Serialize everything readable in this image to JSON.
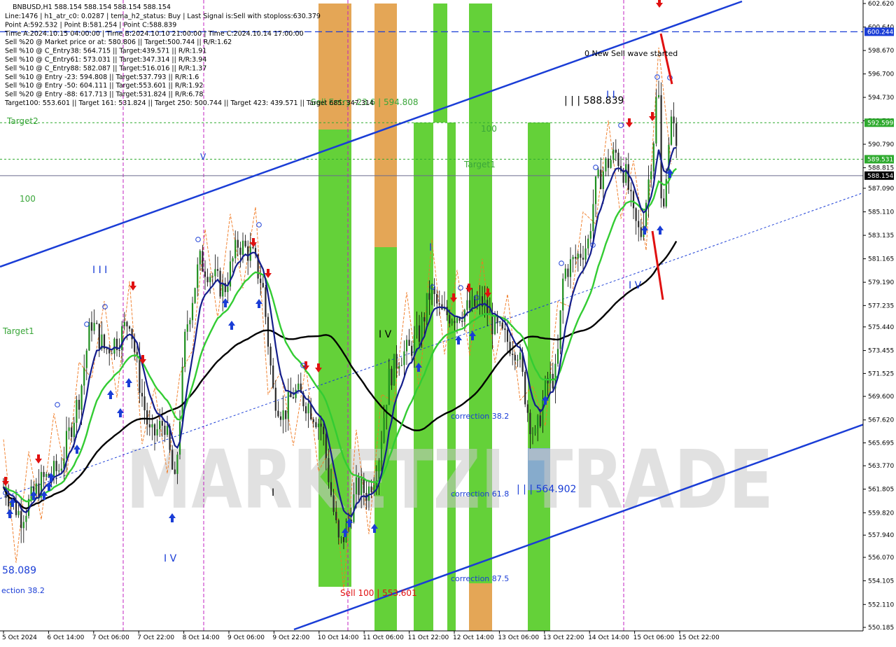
{
  "header": {
    "symbol_line": "BNBUSD,H1  588.154 588.154 588.154 588.154",
    "info_lines": [
      "Line:1476 | h1_atr_c0: 0.0287 | tema_h2_status: Buy | Last Signal is:Sell with stoploss:630.379",
      "Point A:592.532 | Point B:581.254 | Point C:588.839",
      "Time A:2024.10.15 04:00:00 | Time B:2024.10.10 21:00:00 | Time C:2024.10.14 17:00:00",
      "Sell %20 @ Market price or at: 580.806 || Target:500.744 || R/R:1.62",
      "Sell %10 @ C_Entry38: 564.715 || Target:439.571 || R/R:1.91",
      "Sell %10 @ C_Entry61: 573.031 || Target:347.314 || R/R:3.94",
      "Sell %10 @ C_Entry88: 582.087 || Target:516.016 || R/R:1.37",
      "Sell %10 @ Entry -23: 594.808 || Target:537.793 || R/R:1.6",
      "Sell %10 @ Entry -50: 604.111 || Target:553.601 || R/R:1.92",
      "Sell %20 @ Entry -88: 617.713 || Target:531.824 || R/R:6.78",
      "Target100: 553.601 || Target 161: 531.824 || Target 250: 500.744 || Target 423: 439.571 || Target 685: 347.314"
    ]
  },
  "price_axis": {
    "ticks": [
      "602.620",
      "600.640",
      "598.670",
      "596.700",
      "594.730",
      "592.760",
      "590.790",
      "588.815",
      "587.090",
      "585.110",
      "583.135",
      "581.165",
      "579.190",
      "577.235",
      "575.440",
      "573.455",
      "571.525",
      "569.600",
      "567.620",
      "565.695",
      "563.770",
      "561.805",
      "559.820",
      "557.940",
      "556.070",
      "554.105",
      "552.110",
      "550.185"
    ],
    "tags": [
      {
        "value": "600.244",
        "color": "#1a3dd6"
      },
      {
        "value": "592.599",
        "color": "#2eaa2e"
      },
      {
        "value": "589.531",
        "color": "#2eaa2e"
      },
      {
        "value": "588.154",
        "color": "#000000"
      }
    ]
  },
  "time_axis": {
    "labels": [
      "5 Oct 2024",
      "6 Oct 14:00",
      "7 Oct 06:00",
      "7 Oct 22:00",
      "8 Oct 14:00",
      "9 Oct 06:00",
      "9 Oct 22:00",
      "10 Oct 14:00",
      "11 Oct 06:00",
      "11 Oct 22:00",
      "12 Oct 14:00",
      "13 Oct 06:00",
      "13 Oct 22:00",
      "14 Oct 14:00",
      "15 Oct 06:00",
      "15 Oct 22:00"
    ]
  },
  "annotations": {
    "watermark": "MARKETZI TRADE",
    "sell_entry": "Sell Entry -23.6 | 594.808",
    "point_c": "| | | 588.839",
    "point_b": "| | | 564.902",
    "new_wave": "0 New Sell wave started",
    "sell_100": "Sell 100 | 553.601",
    "target1_mid": "Target1",
    "target1_left": "Target1",
    "target2_left": "Target2",
    "level_100_left": "100",
    "level_100_mid": "100",
    "corr_382": "correction 38.2",
    "corr_618": "correction 61.8",
    "corr_875": "correction 87.5",
    "corr_left": "ection 38.2",
    "left_price": "58.089",
    "wave_iii": "I I I",
    "wave_i": "I",
    "wave_iv": "I V",
    "wave_v": "V",
    "wave_iv_low": "I V",
    "wave_iv_right": "I V",
    "wave_i_mid": "I",
    "wave_ii_right": "I I"
  },
  "chart_data": {
    "type": "candlestick",
    "symbol": "BNBUSD",
    "timeframe": "H1",
    "ylim": [
      550.185,
      602.62
    ],
    "last_price": 588.154,
    "horizontal_levels": [
      {
        "value": 600.244,
        "style": "dashed",
        "color": "#1a3dd6"
      },
      {
        "value": 592.599,
        "style": "dotted",
        "color": "#2eaa2e"
      },
      {
        "value": 589.531,
        "style": "dotted",
        "color": "#2eaa2e"
      },
      {
        "value": 588.154,
        "style": "solid",
        "color": "#6b6b8e"
      }
    ],
    "colors": {
      "channel": "#1a3dd6",
      "ma_slow": "#000000",
      "ma_mid": "#33cc33",
      "ma_fast": "#141e8c",
      "zone_green": "#5ccf2e",
      "zone_orange": "#e3a14d",
      "signal_red": "#e01010",
      "signal_blue": "#1a3dd6"
    }
  }
}
